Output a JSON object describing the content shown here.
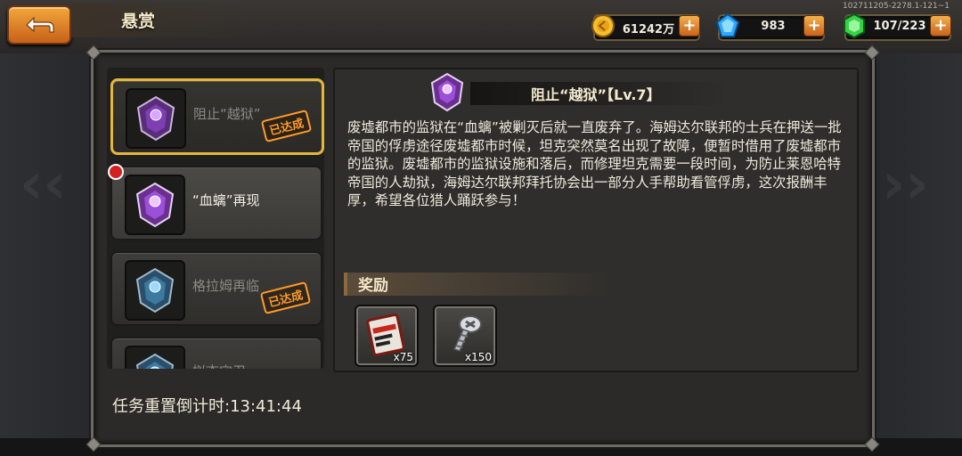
{
  "header": {
    "title": "悬赏",
    "build_info": "102711205-2278.1-121~1"
  },
  "resources": [
    {
      "icon": "gold-coin-icon",
      "value": "61242万"
    },
    {
      "icon": "blue-gem-icon",
      "value": "983"
    },
    {
      "icon": "green-energy-icon",
      "value": "107/223"
    }
  ],
  "missions": [
    {
      "name": "阻止“越狱”",
      "status": "已达成",
      "selected": true
    },
    {
      "name": "“血螭”再现",
      "status": "",
      "selected": false
    },
    {
      "name": "格拉姆再临",
      "status": "已达成",
      "selected": false
    },
    {
      "name": "拟态守卫",
      "status": "",
      "selected": false
    }
  ],
  "detail": {
    "title": "阻止“越狱”【Lv.7】",
    "description": "废墟都市的监狱在“血螭”被剿灭后就一直废弃了。海姆达尔联邦的士兵在押送一批帝国的俘虏途径废墟都市时候，坦克突然莫名出现了故障，便暂时借用了废墟都市的监狱。废墟都市的监狱设施和落后，而修理坦克需要一段时间，为防止莱恩哈特帝国的人劫狱，海姆达尔联邦拜托协会出一部分人手帮助看管俘虏，这次报酬丰厚，希望各位猎人踊跃参与！",
    "reward_label": "奖励",
    "rewards": [
      {
        "icon": "ticket-scroll-icon",
        "qty": "x75"
      },
      {
        "icon": "screw-icon",
        "qty": "x150"
      }
    ]
  },
  "footer": {
    "timer": "任务重置倒计时:13:41:44"
  },
  "colors": {
    "accent": "#e4b73b",
    "stamp": "#ff9b2a",
    "button": "#e08a2a"
  }
}
